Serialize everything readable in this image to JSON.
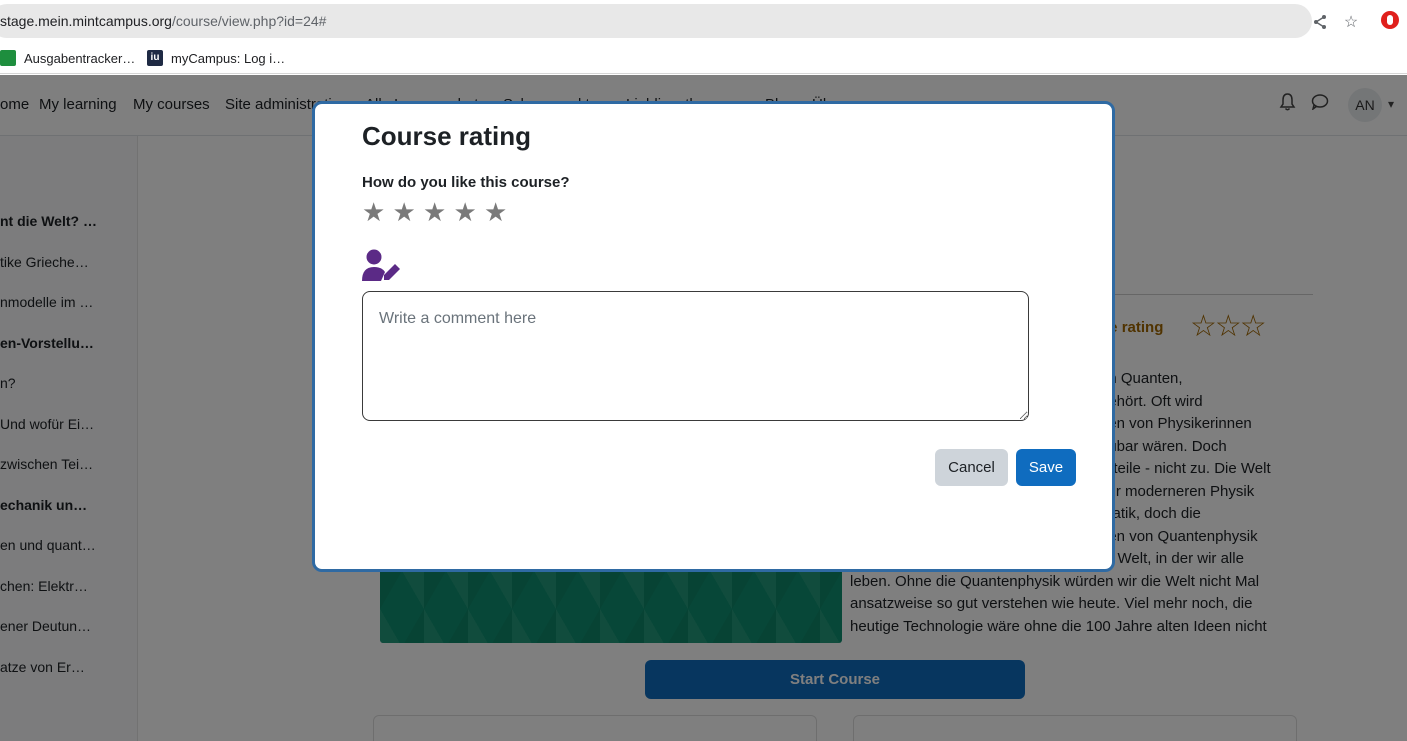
{
  "browser": {
    "url_host": "stage.mein.mintcampus.org",
    "url_path": "/course/view.php?id=24#",
    "icons": [
      "share-icon",
      "bookmark-star-icon",
      "extension-icon"
    ],
    "bookmarks": [
      {
        "label": "Ausgabentracker…",
        "icon": "sheets-icon"
      },
      {
        "label": "myCampus: Log i…",
        "icon": "iu-icon"
      }
    ]
  },
  "navbar": {
    "items": [
      "ome",
      "My learning",
      "My courses",
      "Site administration",
      "Alle Lernangebote",
      "Schwerpunkte",
      "Lieblingsthemen",
      "Blog",
      "Über uns"
    ],
    "avatar": "AN",
    "icons": [
      "bell-icon",
      "chat-icon",
      "chevron-down-icon"
    ]
  },
  "sidebar": {
    "items": [
      {
        "label": "nt die Welt? …",
        "bold": true
      },
      {
        "label": "tike Grieche…",
        "bold": false
      },
      {
        "label": "nmodelle im …",
        "bold": false
      },
      {
        "label": "en-Vorstellu…",
        "bold": true
      },
      {
        "label": "n?",
        "bold": false
      },
      {
        "label": "Und wofür Ei…",
        "bold": false
      },
      {
        "label": "zwischen Tei…",
        "bold": false
      },
      {
        "label": "echanik un…",
        "bold": true
      },
      {
        "label": "en und quant…",
        "bold": false
      },
      {
        "label": "chen: Elektr…",
        "bold": false
      },
      {
        "label": "ener Deutun…",
        "bold": false
      },
      {
        "label": "atze von Er…",
        "bold": false
      }
    ]
  },
  "course": {
    "rating_label": "rse rating",
    "rating_stars": "☆☆☆",
    "description_lines": [
      "on Quanten,",
      "gehört. Oft wird",
      "rien von Physikerinnen",
      "aubar wären. Doch",
      "urteile - nicht zu. Die Welt",
      "zur moderneren Physik",
      "matik, doch die",
      "ben von Quantenphysik",
      "er Welt, in der wir alle",
      "leben. Ohne die Quantenphysik würden wir die Welt nicht Mal",
      "ansatzweise so gut verstehen wie heute. Viel mehr noch, die",
      "heutige Technologie wäre ohne die 100 Jahre alten Ideen nicht"
    ],
    "start_button": "Start Course"
  },
  "modal": {
    "title": "Course rating",
    "question": "How do you like this course?",
    "rating": {
      "value": 0,
      "max": 5,
      "star_glyph": "★"
    },
    "comment_placeholder": "Write a comment here",
    "comment_value": "",
    "cancel_label": "Cancel",
    "save_label": "Save",
    "accent_color": "#0f6cbf",
    "icon_color": "#5b2a86"
  }
}
